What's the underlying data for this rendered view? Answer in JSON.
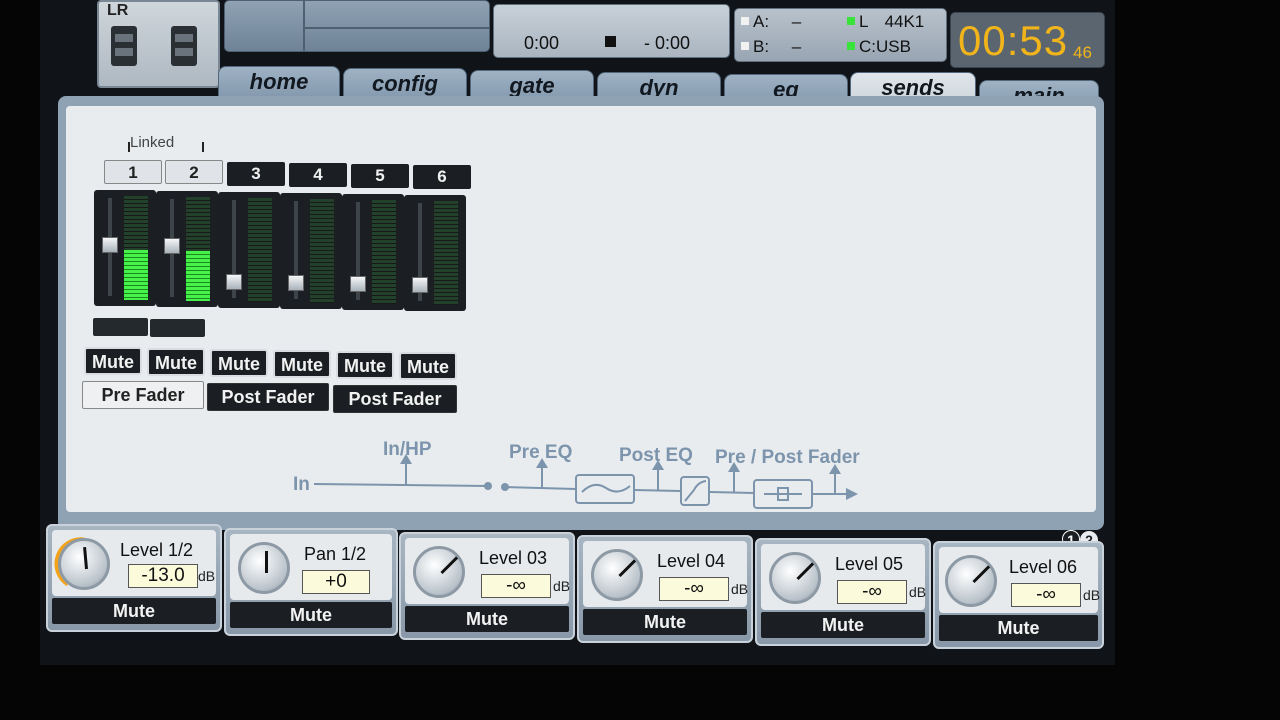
{
  "header": {
    "lr_label": "LR",
    "transport": {
      "elapsed": "0:00",
      "remaining": "- 0:00"
    },
    "io": {
      "a_label": "A:",
      "a_value": "–",
      "b_label": "B:",
      "b_value": "–",
      "l_label": "L",
      "rate": "44K1",
      "c_label": "C:",
      "source": "USB"
    },
    "clock": {
      "main": "00:53",
      "seconds": "46"
    }
  },
  "tabs": [
    {
      "label": "home"
    },
    {
      "label": "config"
    },
    {
      "label": "gate"
    },
    {
      "label": "dyn"
    },
    {
      "label": "eq"
    },
    {
      "label": "sends"
    },
    {
      "label": "main"
    }
  ],
  "active_tab": "sends",
  "sends": {
    "linked_label": "Linked",
    "channels": [
      {
        "num": "1",
        "mute": "Mute",
        "level_fraction": 0.52,
        "meter_fraction": 0.48
      },
      {
        "num": "2",
        "mute": "Mute",
        "level_fraction": 0.52,
        "meter_fraction": 0.48
      },
      {
        "num": "3",
        "mute": "Mute",
        "level_fraction": 0.1,
        "meter_fraction": 0
      },
      {
        "num": "4",
        "mute": "Mute",
        "level_fraction": 0.1,
        "meter_fraction": 0
      },
      {
        "num": "5",
        "mute": "Mute",
        "level_fraction": 0.1,
        "meter_fraction": 0
      },
      {
        "num": "6",
        "mute": "Mute",
        "level_fraction": 0.1,
        "meter_fraction": 0
      }
    ],
    "tap_points": [
      "Pre Fader",
      "Post Fader",
      "Post Fader"
    ]
  },
  "signal_path": {
    "in": "In",
    "in_hp": "In/HP",
    "pre_eq": "Pre EQ",
    "post_eq": "Post EQ",
    "pre_post_fader": "Pre / Post Fader"
  },
  "page_indicator": {
    "page1": "1",
    "page2": "2"
  },
  "encoders": [
    {
      "label": "Level 1/2",
      "value": "-13.0",
      "unit": "dB",
      "mute": "Mute"
    },
    {
      "label": "Pan 1/2",
      "value": "+0",
      "unit": "",
      "mute": "Mute"
    },
    {
      "label": "Level 03",
      "value": "-∞",
      "unit": "dB",
      "mute": "Mute"
    },
    {
      "label": "Level 04",
      "value": "-∞",
      "unit": "dB",
      "mute": "Mute"
    },
    {
      "label": "Level 05",
      "value": "-∞",
      "unit": "dB",
      "mute": "Mute"
    },
    {
      "label": "Level 06",
      "value": "-∞",
      "unit": "dB",
      "mute": "Mute"
    }
  ],
  "colors": {
    "clock": "#f1b41a",
    "meter_green": "#46f24a",
    "signal_path": "#7d94ad"
  }
}
